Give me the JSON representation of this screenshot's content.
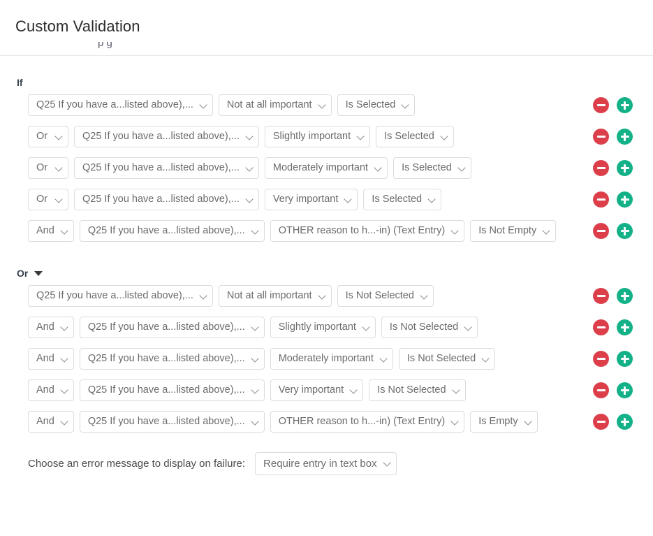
{
  "header": {
    "title": "Custom Validation",
    "clipped_text": "p                  g"
  },
  "icons": {
    "chevron_down": "chevron-down-icon",
    "caret_down_solid": "caret-down-solid-icon",
    "remove": "remove-circle-icon",
    "add": "add-circle-icon"
  },
  "colors": {
    "remove_red": "#dd3f4a",
    "add_green": "#13b187",
    "label_text": "#36414d",
    "select_text": "#6b6b6b",
    "select_border": "#dcdcdc"
  },
  "groups": [
    {
      "label": "If",
      "has_caret": false,
      "rows": [
        {
          "conjunction": null,
          "question": "Q25 If you have a...listed above),...",
          "value": "Not at all important",
          "operator": "Is Selected",
          "remove_label": "remove-condition",
          "add_label": "add-condition"
        },
        {
          "conjunction": "Or",
          "question": "Q25 If you have a...listed above),...",
          "value": "Slightly important",
          "operator": "Is Selected",
          "remove_label": "remove-condition",
          "add_label": "add-condition"
        },
        {
          "conjunction": "Or",
          "question": "Q25 If you have a...listed above),...",
          "value": "Moderately important",
          "operator": "Is Selected",
          "remove_label": "remove-condition",
          "add_label": "add-condition"
        },
        {
          "conjunction": "Or",
          "question": "Q25 If you have a...listed above),...",
          "value": "Very important",
          "operator": "Is Selected",
          "remove_label": "remove-condition",
          "add_label": "add-condition"
        },
        {
          "conjunction": "And",
          "question": "Q25 If you have a...listed above),...",
          "value": "OTHER reason to h...-in) (Text Entry)",
          "operator": "Is Not Empty",
          "remove_label": "remove-condition",
          "add_label": "add-condition"
        }
      ]
    },
    {
      "label": "Or",
      "has_caret": true,
      "rows": [
        {
          "conjunction": null,
          "question": "Q25 If you have a...listed above),...",
          "value": "Not at all important",
          "operator": "Is Not Selected",
          "remove_label": "remove-condition",
          "add_label": "add-condition"
        },
        {
          "conjunction": "And",
          "question": "Q25 If you have a...listed above),...",
          "value": "Slightly important",
          "operator": "Is Not Selected",
          "remove_label": "remove-condition",
          "add_label": "add-condition"
        },
        {
          "conjunction": "And",
          "question": "Q25 If you have a...listed above),...",
          "value": "Moderately important",
          "operator": "Is Not Selected",
          "remove_label": "remove-condition",
          "add_label": "add-condition"
        },
        {
          "conjunction": "And",
          "question": "Q25 If you have a...listed above),...",
          "value": "Very important",
          "operator": "Is Not Selected",
          "remove_label": "remove-condition",
          "add_label": "add-condition"
        },
        {
          "conjunction": "And",
          "question": "Q25 If you have a...listed above),...",
          "value": "OTHER reason to h...-in) (Text Entry)",
          "operator": "Is Empty",
          "remove_label": "remove-condition",
          "add_label": "add-condition"
        }
      ]
    }
  ],
  "footer": {
    "error_message_label": "Choose an error message to display on failure:",
    "error_message_value": "Require entry in text box"
  }
}
